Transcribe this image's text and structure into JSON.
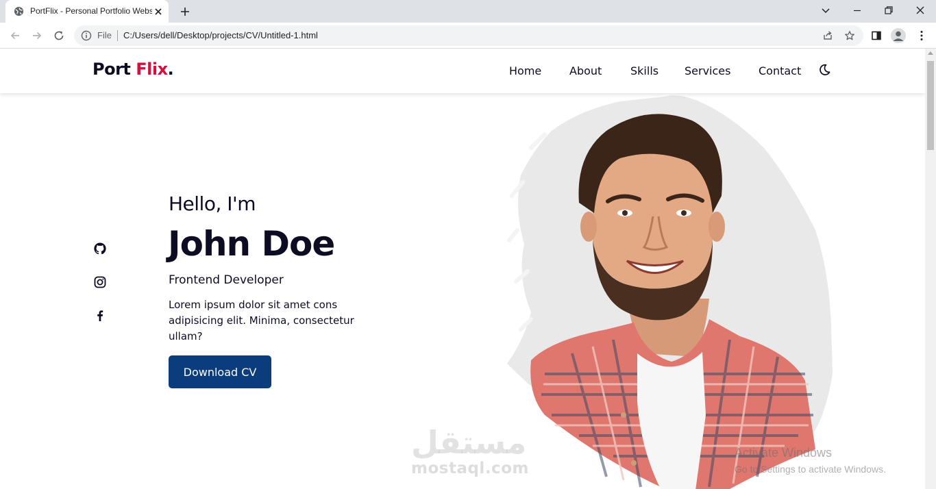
{
  "browser": {
    "tab_title": "PortFlix - Personal Portfolio Website",
    "omnibox_scheme": "File",
    "url": "C:/Users/dell/Desktop/projects/CV/Untitled-1.html"
  },
  "site": {
    "logo_main": "Port ",
    "logo_accent": "Flix",
    "logo_dot": ".",
    "accent_color": "#d1113f",
    "nav": [
      "Home",
      "About",
      "Skills",
      "Services",
      "Contact"
    ],
    "theme_toggle_icon": "moon-icon"
  },
  "hero": {
    "greeting": "Hello, I'm",
    "name": "John Doe",
    "role": "Frontend Developer",
    "description": "Lorem ipsum dolor sit amet cons adipisicing elit. Minima, consectetur ullam?",
    "cta_label": "Download CV",
    "cta_color": "#0b3c7b",
    "socials": [
      "github-icon",
      "instagram-icon",
      "facebook-icon"
    ]
  },
  "overlays": {
    "watermark_arabic": "مستقل",
    "watermark_latin": "mostaql.com",
    "activate_title": "Activate Windows",
    "activate_subtitle": "Go to Settings to activate Windows."
  }
}
